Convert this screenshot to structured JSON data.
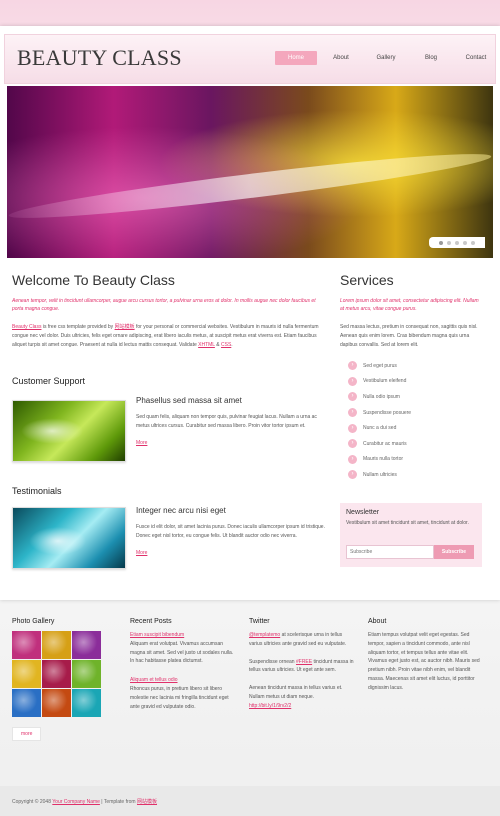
{
  "brand": {
    "logo_text": "BEAUTY CLASS"
  },
  "nav": [
    {
      "label": "Home",
      "active": true
    },
    {
      "label": "About",
      "active": false
    },
    {
      "label": "Gallery",
      "active": false
    },
    {
      "label": "Blog",
      "active": false
    },
    {
      "label": "Contact",
      "active": false
    }
  ],
  "slider": {
    "slide_count": 5,
    "active_index": 0
  },
  "welcome": {
    "title": "Welcome To Beauty Class",
    "lead": "Aenean tempor, velit in tincidunt ullamcorper, augue arcu cursus tortor, a pulvinar urna eros at dolor. In mollis augue nec dolor faucibus et porta magna congue.",
    "body_link": "Beauty Class",
    "body_part1": " is free css template provided by ",
    "body_link2": "网站模板",
    "body_part2": " for your personal or commercial websites. Vestibulum in mauris id nulla fermentum congue nec vel dolor. Duis ultricies, felis eget ornare adipiscing, erat libero iaculis metus, at suscipit metus erat viverra est. Etiam faucibus aliquet turpis sit amet congue. Praesent at nulla id lectus mattis consequat. Validate ",
    "xhtml_link": "XHTML",
    "and_text": " & ",
    "css_link": "CSS",
    "period": "."
  },
  "services": {
    "title": "Services",
    "lead": "Lorem ipsum dolor sit amet, consectetur adipiscing elit. Nullam at metus arcu, vitae congue purus.",
    "body": "Sed massa lectus, pretium in consequat non, sagittis quis nisl. Aenean quis enim lorem. Cras bibendum magna quis urna dapibus convallis. Sed at lorem elit.",
    "items": [
      "Sed eget purus",
      "Vestibulum eleifend",
      "Nulla odio ipsum",
      "Suspendisse posuere",
      "Nunc a dui sed",
      "Curabitur ac mauris",
      "Mauris nulla tortor",
      "Nullam ultricies"
    ]
  },
  "support": {
    "title": "Customer Support",
    "heading": "Phasellus sed massa sit amet",
    "text": "Sed quam felis, aliquam non tempor quis, pulvinar feugiat lacus. Nullam a urna ac metus ultrices cursus. Curabitur sed massa libero. Proin vitor tortor ipsum et.",
    "more": "More"
  },
  "testimonials": {
    "title": "Testimonials",
    "heading": "Integer nec arcu nisi eget",
    "text": "Fusce id elit dolor, sit amet lacinia purus. Donec iaculis ullamcorper ipsum id tristique. Donec eget nisl tortor, eu congue felis. Ut blandit auctor odio nec viverra.",
    "more": "More"
  },
  "newsletter": {
    "title": "Newsletter",
    "text": "Vestibulum sit amet tincidunt sit amet, tincidunt at dolor.",
    "placeholder": "Subscribe",
    "button": "Subscribe"
  },
  "footer": {
    "gallery": {
      "title": "Photo Gallery",
      "thumb_colors": [
        "#c0307d",
        "#d6a016",
        "#8b2d9a",
        "#e1b521",
        "#a71c4a",
        "#6fb32a",
        "#2a6fc4",
        "#c44a12",
        "#1aa6b5"
      ],
      "more": "more"
    },
    "posts": {
      "title": "Recent Posts",
      "items": [
        {
          "link": "Etiam suscipit bibendum",
          "text": "Aliquam erat volutpat. Vivamus accumsan magna sit amet. Sed vel justo ut sodales nulla. In hac habitasse platea dictumst."
        },
        {
          "link": "Aliquam et tellus odio",
          "text": "Rhoncus purus, in pretium libero sit libero molestie nec lacinia mi fringilla tincidunt eget ante gravid ed vulputate odio."
        }
      ]
    },
    "twitter": {
      "title": "Twitter",
      "tweets": [
        {
          "link": "@templatemo",
          "text": " at scelerisque urna in tellus varius ultricies ante gravid sed eu vulputate."
        },
        {
          "text1": "Suspendisse ornean ",
          "link": "#FREE",
          "text2": " tincidunt massa in tellus varius ultricies. Ut eget ante sem."
        },
        {
          "text": "Aenean tincidunt massa in tellus varius et. Nullam metus ut diam neque.",
          "link": "http://bit.ly/1/9rv2/2"
        }
      ]
    },
    "about": {
      "title": "About",
      "text": "Etiam tempus volutpat velit eget egestas. Sed tempor, sapien a tincidunt commodo, ante nisl aliquam tortor, et tempus tellus ante vitae elit. Vivamus eget justo est, ac auctor nibh. Mauris sed pretium nibh. Proin vitae nibh enim, vel blandit massa. Maecenas sit amet elit luctus, id porttitor dignissim lacus."
    },
    "copyright_prefix": "Copyright © 2048 ",
    "company_link": "Your Company Name",
    "template_text": " | Template from ",
    "template_link": "网站模板"
  },
  "colors": {
    "accent_pink": "#e0306a",
    "nav_active": "#f4a7bd",
    "bullet": "#f4b5c8"
  }
}
